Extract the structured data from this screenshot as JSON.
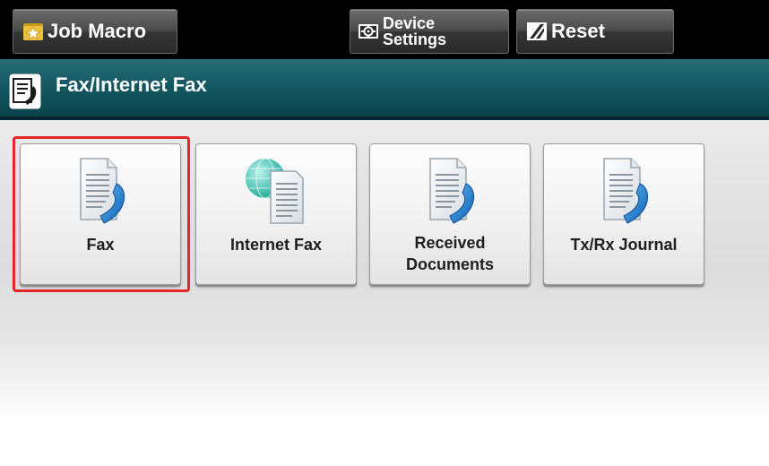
{
  "toolbar": {
    "job_macro_label": "Job Macro",
    "job_macro_icon": "star-folder-icon",
    "device_settings_line1": "Device",
    "device_settings_line2": "Settings",
    "device_settings_icon": "device-settings-icon",
    "reset_label": "Reset",
    "reset_icon": "reset-icon"
  },
  "header": {
    "title": "Fax/Internet Fax",
    "icon": "fax-icon"
  },
  "tiles": [
    {
      "lines": [
        "Fax"
      ],
      "icon": "fax-icon",
      "selected": true
    },
    {
      "lines": [
        "Internet Fax"
      ],
      "icon": "internet-fax-icon",
      "selected": false
    },
    {
      "lines": [
        "Received",
        "Documents"
      ],
      "icon": "received-documents-icon",
      "selected": false
    },
    {
      "lines": [
        "Tx/Rx Journal"
      ],
      "icon": "journal-icon",
      "selected": false
    }
  ],
  "colors": {
    "accent_selection": "#e2262a",
    "titlebar": "#155a64",
    "phone_blue": "#1d7fd6"
  }
}
